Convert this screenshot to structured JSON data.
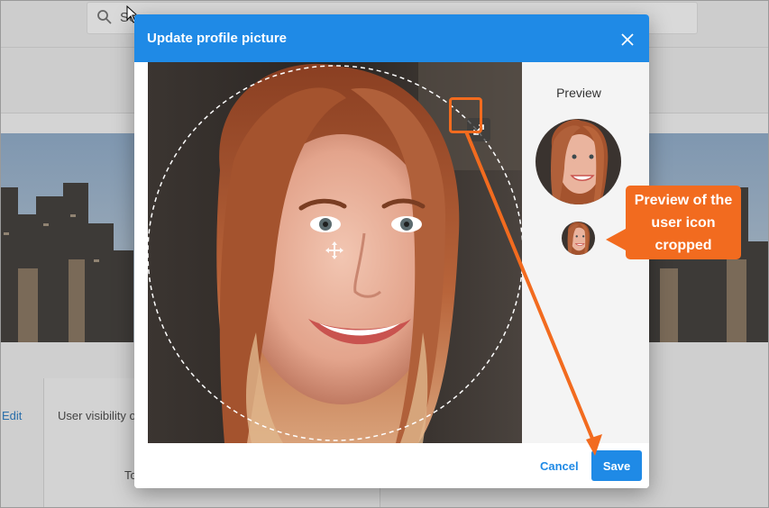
{
  "background": {
    "search_text": "Se",
    "edit_link": "Edit",
    "visibility_label": "User visibility o",
    "row_text": "To"
  },
  "dialog": {
    "title": "Update profile picture",
    "close_icon": "close-icon",
    "crop_resize_icon": "expand-arrows-icon",
    "crop_move_icon": "move-icon"
  },
  "preview": {
    "label": "Preview"
  },
  "footer": {
    "cancel_label": "Cancel",
    "save_label": "Save"
  },
  "annotation": {
    "callout_text": "Preview of the user icon cropped",
    "color": "#f26b1f"
  },
  "colors": {
    "primary": "#1f8ae6",
    "annotation": "#f26b1f"
  }
}
